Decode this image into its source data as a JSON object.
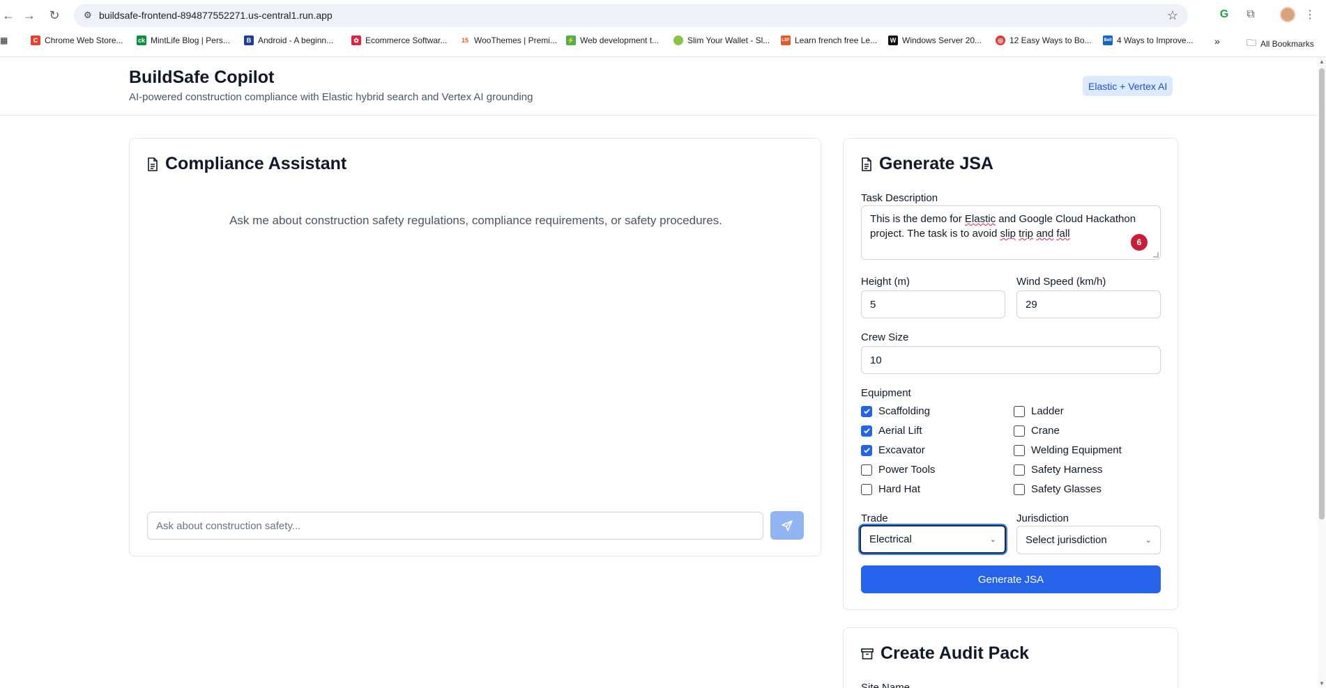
{
  "browser": {
    "url": "buildsafe-frontend-894877552271.us-central1.run.app",
    "bookmarks": [
      {
        "label": "Chrome Web Store...",
        "color": "#e34133",
        "icon": "C"
      },
      {
        "label": "MintLife Blog | Pers...",
        "color": "#0a8f3c",
        "icon": "ck"
      },
      {
        "label": "Android - A beginn...",
        "color": "#1c3f94",
        "icon": "B"
      },
      {
        "label": "Ecommerce Softwar...",
        "color": "#e2213f",
        "icon": "✿"
      },
      {
        "label": "WooThemes | Premi...",
        "color": "#ffffff",
        "icon": "15"
      },
      {
        "label": "Web development t...",
        "color": "#4caf50",
        "icon": "⚡"
      },
      {
        "label": "Slim Your Wallet - Sl...",
        "color": "#8bc34a",
        "icon": "●"
      },
      {
        "label": "Learn french free Le...",
        "color": "#e05a2b",
        "icon": "LSF"
      },
      {
        "label": "Windows Server 20...",
        "color": "#111111",
        "icon": "W"
      },
      {
        "label": "12 Easy Ways to Bo...",
        "color": "#e53935",
        "icon": "◎"
      },
      {
        "label": "4 Ways to Improve...",
        "color": "#1565c0",
        "icon": "Bell"
      }
    ],
    "all_bookmarks": "All Bookmarks"
  },
  "header": {
    "title": "BuildSafe Copilot",
    "subtitle": "AI-powered construction compliance with Elastic hybrid search and Vertex AI grounding",
    "badge": "Elastic + Vertex AI"
  },
  "assistant": {
    "title": "Compliance Assistant",
    "empty_message": "Ask me about construction safety regulations, compliance requirements, or safety procedures.",
    "input_placeholder": "Ask about construction safety..."
  },
  "jsa": {
    "title": "Generate JSA",
    "task_label": "Task Description",
    "task_text_line1_a": "This is the demo for ",
    "task_text_line1_b": "Elastic",
    "task_text_line1_c": " and Google Cloud Hackathon",
    "task_text_line2_a": "project. The task is to avoid ",
    "task_text_line2_b": "slip",
    "task_text_line2_c": " ",
    "task_text_line2_d": "trip",
    "task_text_line2_e": " ",
    "task_text_line2_f": "and",
    "task_text_line2_g": " ",
    "task_text_line2_h": "fall",
    "grammar_badge": "6",
    "height_label": "Height (m)",
    "height_value": "5",
    "wind_label": "Wind Speed (km/h)",
    "wind_value": "29",
    "crew_label": "Crew Size",
    "crew_value": "10",
    "equipment_label": "Equipment",
    "equipment": [
      {
        "label": "Scaffolding",
        "checked": true
      },
      {
        "label": "Ladder",
        "checked": false
      },
      {
        "label": "Aerial Lift",
        "checked": true
      },
      {
        "label": "Crane",
        "checked": false
      },
      {
        "label": "Excavator",
        "checked": true
      },
      {
        "label": "Welding Equipment",
        "checked": false
      },
      {
        "label": "Power Tools",
        "checked": false
      },
      {
        "label": "Safety Harness",
        "checked": false
      },
      {
        "label": "Hard Hat",
        "checked": false
      },
      {
        "label": "Safety Glasses",
        "checked": false
      }
    ],
    "trade_label": "Trade",
    "trade_value": "Electrical",
    "jurisdiction_label": "Jurisdiction",
    "jurisdiction_value": "Select jurisdiction",
    "generate_button": "Generate JSA"
  },
  "audit": {
    "title": "Create Audit Pack",
    "site_label": "Site Name"
  },
  "colors": {
    "primary": "#2563eb",
    "send_disabled": "#93b4f2",
    "badge_bg": "#dbeafe"
  }
}
